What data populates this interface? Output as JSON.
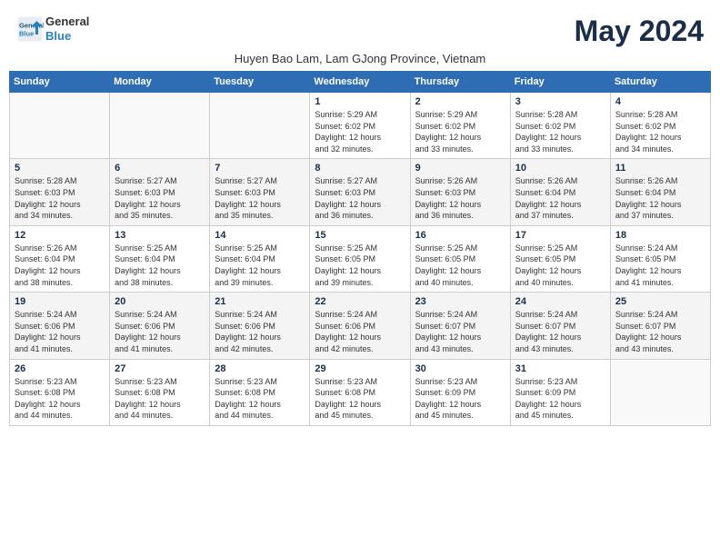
{
  "header": {
    "logo_line1": "General",
    "logo_line2": "Blue",
    "month_year": "May 2024",
    "location": "Huyen Bao Lam, Lam GJong Province, Vietnam"
  },
  "weekdays": [
    "Sunday",
    "Monday",
    "Tuesday",
    "Wednesday",
    "Thursday",
    "Friday",
    "Saturday"
  ],
  "weeks": [
    [
      {
        "day": "",
        "info": ""
      },
      {
        "day": "",
        "info": ""
      },
      {
        "day": "",
        "info": ""
      },
      {
        "day": "1",
        "info": "Sunrise: 5:29 AM\nSunset: 6:02 PM\nDaylight: 12 hours\nand 32 minutes."
      },
      {
        "day": "2",
        "info": "Sunrise: 5:29 AM\nSunset: 6:02 PM\nDaylight: 12 hours\nand 33 minutes."
      },
      {
        "day": "3",
        "info": "Sunrise: 5:28 AM\nSunset: 6:02 PM\nDaylight: 12 hours\nand 33 minutes."
      },
      {
        "day": "4",
        "info": "Sunrise: 5:28 AM\nSunset: 6:02 PM\nDaylight: 12 hours\nand 34 minutes."
      }
    ],
    [
      {
        "day": "5",
        "info": "Sunrise: 5:28 AM\nSunset: 6:03 PM\nDaylight: 12 hours\nand 34 minutes."
      },
      {
        "day": "6",
        "info": "Sunrise: 5:27 AM\nSunset: 6:03 PM\nDaylight: 12 hours\nand 35 minutes."
      },
      {
        "day": "7",
        "info": "Sunrise: 5:27 AM\nSunset: 6:03 PM\nDaylight: 12 hours\nand 35 minutes."
      },
      {
        "day": "8",
        "info": "Sunrise: 5:27 AM\nSunset: 6:03 PM\nDaylight: 12 hours\nand 36 minutes."
      },
      {
        "day": "9",
        "info": "Sunrise: 5:26 AM\nSunset: 6:03 PM\nDaylight: 12 hours\nand 36 minutes."
      },
      {
        "day": "10",
        "info": "Sunrise: 5:26 AM\nSunset: 6:04 PM\nDaylight: 12 hours\nand 37 minutes."
      },
      {
        "day": "11",
        "info": "Sunrise: 5:26 AM\nSunset: 6:04 PM\nDaylight: 12 hours\nand 37 minutes."
      }
    ],
    [
      {
        "day": "12",
        "info": "Sunrise: 5:26 AM\nSunset: 6:04 PM\nDaylight: 12 hours\nand 38 minutes."
      },
      {
        "day": "13",
        "info": "Sunrise: 5:25 AM\nSunset: 6:04 PM\nDaylight: 12 hours\nand 38 minutes."
      },
      {
        "day": "14",
        "info": "Sunrise: 5:25 AM\nSunset: 6:04 PM\nDaylight: 12 hours\nand 39 minutes."
      },
      {
        "day": "15",
        "info": "Sunrise: 5:25 AM\nSunset: 6:05 PM\nDaylight: 12 hours\nand 39 minutes."
      },
      {
        "day": "16",
        "info": "Sunrise: 5:25 AM\nSunset: 6:05 PM\nDaylight: 12 hours\nand 40 minutes."
      },
      {
        "day": "17",
        "info": "Sunrise: 5:25 AM\nSunset: 6:05 PM\nDaylight: 12 hours\nand 40 minutes."
      },
      {
        "day": "18",
        "info": "Sunrise: 5:24 AM\nSunset: 6:05 PM\nDaylight: 12 hours\nand 41 minutes."
      }
    ],
    [
      {
        "day": "19",
        "info": "Sunrise: 5:24 AM\nSunset: 6:06 PM\nDaylight: 12 hours\nand 41 minutes."
      },
      {
        "day": "20",
        "info": "Sunrise: 5:24 AM\nSunset: 6:06 PM\nDaylight: 12 hours\nand 41 minutes."
      },
      {
        "day": "21",
        "info": "Sunrise: 5:24 AM\nSunset: 6:06 PM\nDaylight: 12 hours\nand 42 minutes."
      },
      {
        "day": "22",
        "info": "Sunrise: 5:24 AM\nSunset: 6:06 PM\nDaylight: 12 hours\nand 42 minutes."
      },
      {
        "day": "23",
        "info": "Sunrise: 5:24 AM\nSunset: 6:07 PM\nDaylight: 12 hours\nand 43 minutes."
      },
      {
        "day": "24",
        "info": "Sunrise: 5:24 AM\nSunset: 6:07 PM\nDaylight: 12 hours\nand 43 minutes."
      },
      {
        "day": "25",
        "info": "Sunrise: 5:24 AM\nSunset: 6:07 PM\nDaylight: 12 hours\nand 43 minutes."
      }
    ],
    [
      {
        "day": "26",
        "info": "Sunrise: 5:23 AM\nSunset: 6:08 PM\nDaylight: 12 hours\nand 44 minutes."
      },
      {
        "day": "27",
        "info": "Sunrise: 5:23 AM\nSunset: 6:08 PM\nDaylight: 12 hours\nand 44 minutes."
      },
      {
        "day": "28",
        "info": "Sunrise: 5:23 AM\nSunset: 6:08 PM\nDaylight: 12 hours\nand 44 minutes."
      },
      {
        "day": "29",
        "info": "Sunrise: 5:23 AM\nSunset: 6:08 PM\nDaylight: 12 hours\nand 45 minutes."
      },
      {
        "day": "30",
        "info": "Sunrise: 5:23 AM\nSunset: 6:09 PM\nDaylight: 12 hours\nand 45 minutes."
      },
      {
        "day": "31",
        "info": "Sunrise: 5:23 AM\nSunset: 6:09 PM\nDaylight: 12 hours\nand 45 minutes."
      },
      {
        "day": "",
        "info": ""
      }
    ]
  ]
}
